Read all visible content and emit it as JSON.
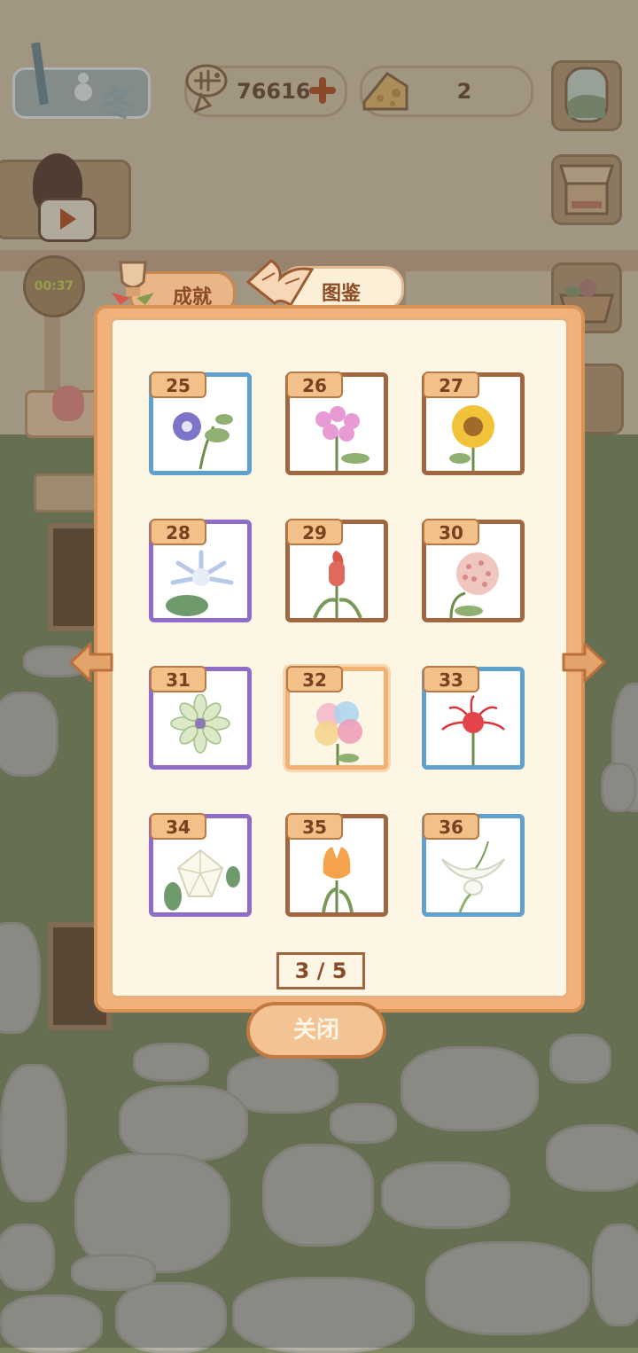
{
  "hud": {
    "season": "冬",
    "fish_coins": "76616",
    "cheese": "2",
    "timer": "00:37"
  },
  "tabs": {
    "achievements": "成就",
    "collection": "图鉴"
  },
  "collection": {
    "cards": [
      {
        "num": "25",
        "frame": "blue",
        "flower": "bellflower"
      },
      {
        "num": "26",
        "frame": "brown",
        "flower": "phlox"
      },
      {
        "num": "27",
        "frame": "brown",
        "flower": "sunflower"
      },
      {
        "num": "28",
        "frame": "purple",
        "flower": "night-blooming-cereus"
      },
      {
        "num": "29",
        "frame": "brown",
        "flower": "celosia"
      },
      {
        "num": "30",
        "frame": "brown",
        "flower": "hoya"
      },
      {
        "num": "31",
        "frame": "purple",
        "flower": "white-dahlia"
      },
      {
        "num": "32",
        "frame": "selected",
        "flower": "rainbow-petals"
      },
      {
        "num": "33",
        "frame": "blue",
        "flower": "red-spider-lily"
      },
      {
        "num": "34",
        "frame": "purple",
        "flower": "datura"
      },
      {
        "num": "35",
        "frame": "brown",
        "flower": "tulip"
      },
      {
        "num": "36",
        "frame": "blue",
        "flower": "egret-orchid"
      }
    ],
    "page": "3 / 5"
  },
  "close_label": "关闭",
  "colors": {
    "panel": "#f2b07b",
    "panel_inner": "#fdf6e5",
    "frame_blue": "#5fa1cc",
    "frame_brown": "#a06640",
    "frame_purple": "#8e6cc7",
    "frame_selected": "#f3b173",
    "accent": "#b4501f"
  }
}
